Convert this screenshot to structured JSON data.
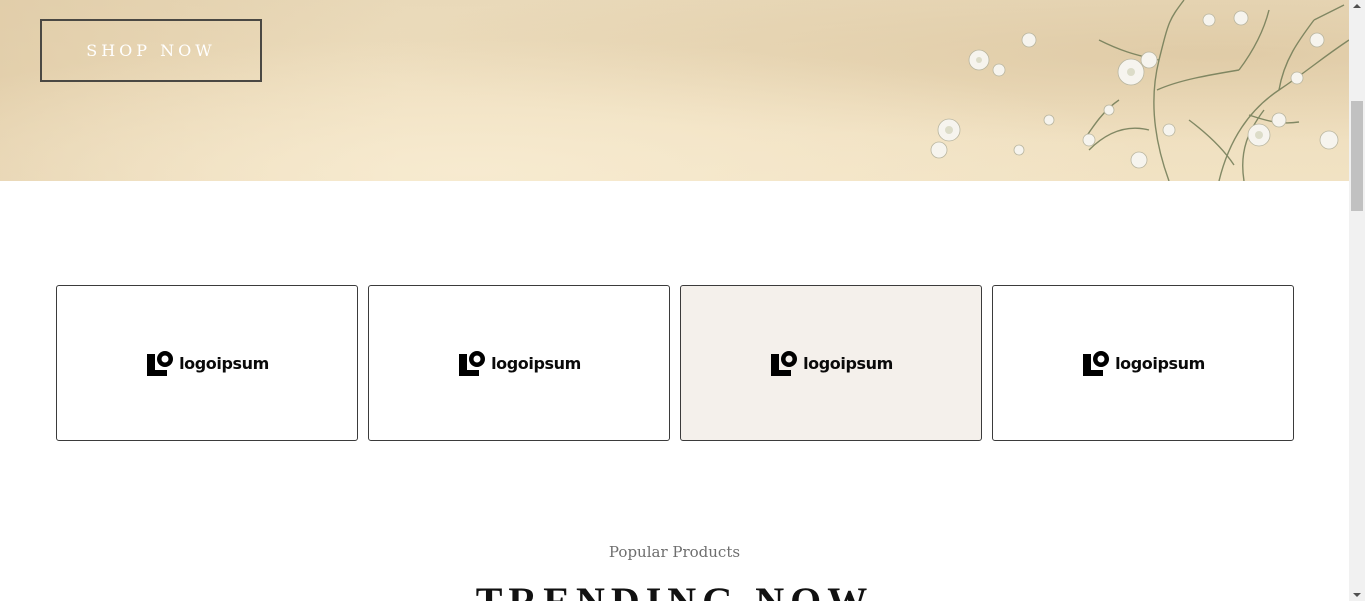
{
  "hero": {
    "cta_label": "SHOP NOW"
  },
  "brands": {
    "items": [
      {
        "name": "logoipsum"
      },
      {
        "name": "logoipsum"
      },
      {
        "name": "logoipsum"
      },
      {
        "name": "logoipsum"
      }
    ],
    "active_index": 2,
    "active_bg": "#f4f0eb"
  },
  "section": {
    "eyebrow": "Popular Products",
    "title": "TRENDING NOW"
  },
  "icons": {
    "brand_mark": "logoipsum-logo-icon",
    "scroll_up": "scroll-up-arrow-icon",
    "scroll_down": "scroll-down-arrow-icon"
  }
}
